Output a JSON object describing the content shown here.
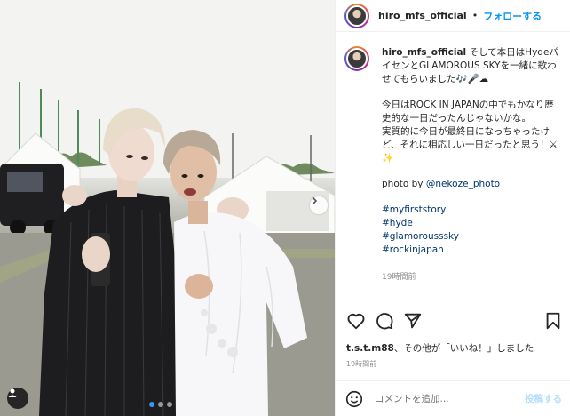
{
  "post": {
    "username": "hiro_mfs_official",
    "separator": "•",
    "follow_label": "フォローする",
    "caption_intro": "そして本日はHydeパイセンとGLAMOROUS SKYを一緒に歌わせてもらいました",
    "caption_intro_emoji": "🎶🎤☁",
    "caption_para2": "今日はROCK IN JAPANの中でもかなり歴史的な一日だったんじゃないかな。",
    "caption_para3": "実質的に今日が最終日になっちゃったけど、それに相応しい一日だったと思う！",
    "caption_para3_emoji": "⚔✨",
    "photo_credit_prefix": "photo by",
    "photo_credit_handle": "@nekoze_photo",
    "hashtags": [
      "#myfirststory",
      "#hyde",
      "#glamorousssky",
      "#rockinjapan"
    ],
    "caption_time": "19時間前",
    "likes_user": "t.s.t.m88",
    "likes_suffix": "、その他が「いいね！」しました",
    "posted_time": "19時間前",
    "comment_placeholder": "コメントを追加...",
    "post_button": "投稿する"
  },
  "icons": {
    "like": "heart-icon",
    "comment": "comment-icon",
    "share": "paper-plane-icon",
    "save": "bookmark-icon",
    "emoji": "smiley-icon",
    "tagged": "user-tag-icon",
    "next": "chevron-right-icon"
  },
  "carousel": {
    "total": 3,
    "active_index": 1
  },
  "colors": {
    "follow": "#0095f6",
    "link": "#00376b",
    "muted": "#8e8e8e"
  }
}
